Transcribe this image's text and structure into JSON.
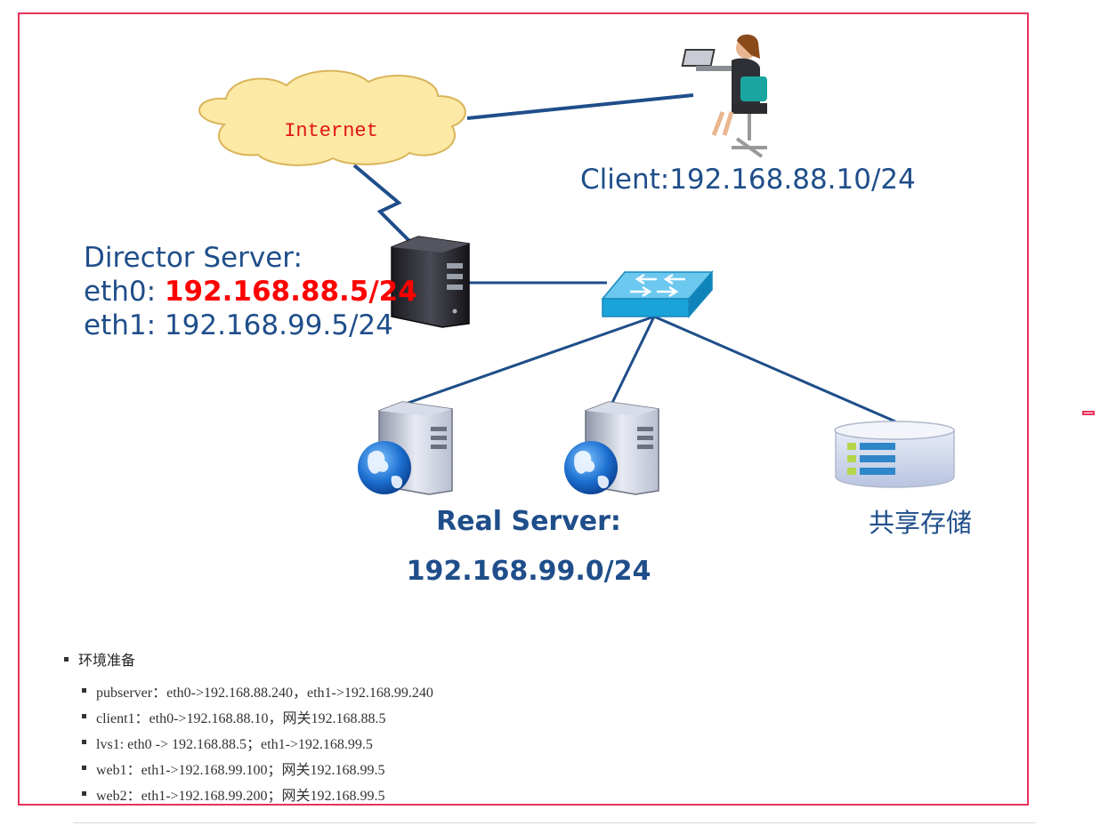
{
  "diagram": {
    "internet_label": "Internet",
    "client_label": "Client:192.168.88.10/24",
    "director": {
      "title": "Director Server:",
      "eth0_prefix": "eth0: ",
      "eth0_ip": "192.168.88.5/24",
      "eth1": "eth1: 192.168.99.5/24"
    },
    "real_server": {
      "title": "Real Server:",
      "subnet": "192.168.99.0/24"
    },
    "storage_label": "共享存储"
  },
  "env": {
    "heading": "环境准备",
    "items": [
      "pubserver：eth0->192.168.88.240，eth1->192.168.99.240",
      "client1：eth0->192.168.88.10，网关192.168.88.5",
      "lvs1: eth0 -> 192.168.88.5；eth1->192.168.99.5",
      "web1：eth1->192.168.99.100；网关192.168.99.5",
      "web2：eth1->192.168.99.200；网关192.168.99.5"
    ]
  },
  "colors": {
    "frame": "#e8315a",
    "link": "#1f4e8a",
    "label_blue": "#1f4e8a",
    "highlight_red": "#ff0000",
    "cloud_fill": "#fde9a6",
    "switch": "#1aa3d9"
  }
}
